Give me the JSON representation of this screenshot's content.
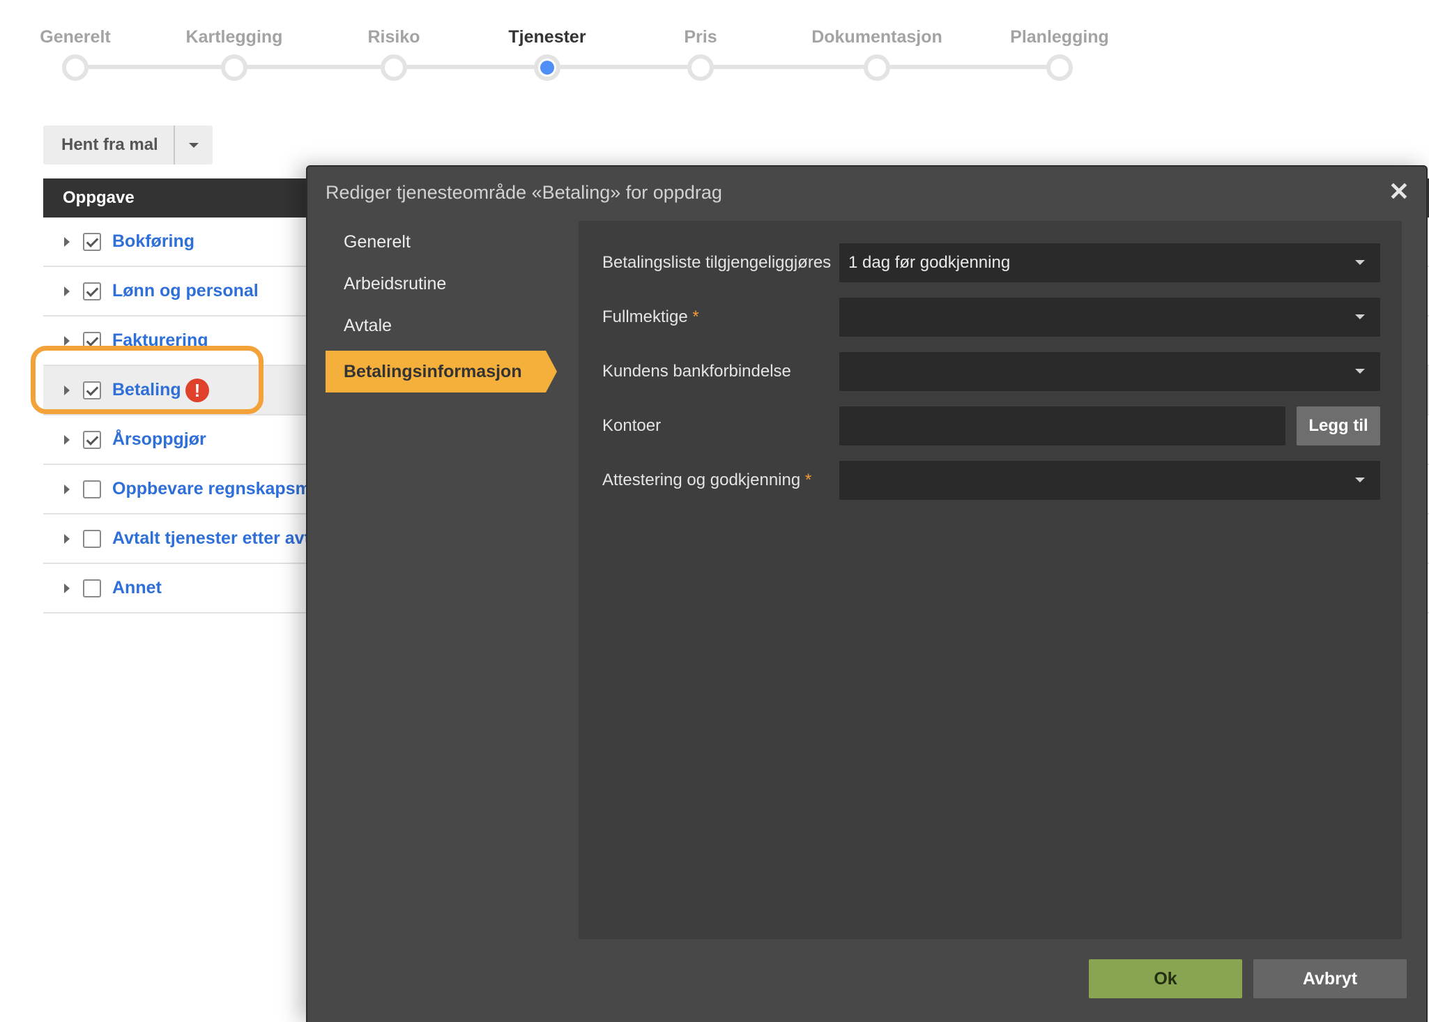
{
  "stepper": {
    "steps": [
      {
        "label": "Generelt",
        "state": "done"
      },
      {
        "label": "Kartlegging",
        "state": "done"
      },
      {
        "label": "Risiko",
        "state": "done"
      },
      {
        "label": "Tjenester",
        "state": "active"
      },
      {
        "label": "Pris",
        "state": "todo"
      },
      {
        "label": "Dokumentasjon",
        "state": "todo"
      },
      {
        "label": "Planlegging",
        "state": "todo"
      }
    ],
    "active_color": "#4f8ef7"
  },
  "template_button": {
    "label": "Hent fra mal",
    "dropdown_icon": "chevron-down-icon"
  },
  "task_table": {
    "header": "Oppgave",
    "rows": [
      {
        "label": "Bokføring",
        "checked": true
      },
      {
        "label": "Lønn og personal",
        "checked": true
      },
      {
        "label": "Fakturering",
        "checked": true
      },
      {
        "label": "Betaling",
        "checked": true,
        "warning": "!"
      },
      {
        "label": "Årsoppgjør",
        "checked": true
      },
      {
        "label": "Oppbevare regnskapsma",
        "checked": false
      },
      {
        "label": "Avtalt tjenester etter avt",
        "checked": false
      },
      {
        "label": "Annet",
        "checked": false
      }
    ],
    "link_color": "#2f6fd8",
    "warning_color": "#e0412a",
    "highlight_color": "#f3a23a"
  },
  "modal": {
    "title": "Rediger tjenesteområde «Betaling» for oppdrag",
    "close_icon": "close-icon",
    "nav": [
      {
        "label": "Generelt",
        "active": false
      },
      {
        "label": "Arbeidsrutine",
        "active": false
      },
      {
        "label": "Avtale",
        "active": false
      },
      {
        "label": "Betalingsinformasjon",
        "active": true
      }
    ],
    "accent_color": "#f5b03c",
    "form": {
      "payment_list": {
        "label": "Betalingsliste tilgjengeliggjøres",
        "value": "1 dag før godkjenning"
      },
      "proxies": {
        "label": "Fullmektige",
        "required": "*",
        "value": ""
      },
      "bank": {
        "label": "Kundens bankforbindelse",
        "value": ""
      },
      "accounts": {
        "label": "Kontoer",
        "value": "",
        "add_label": "Legg til"
      },
      "attestation": {
        "label": "Attestering og godkjenning",
        "required": "*",
        "value": ""
      }
    },
    "ok_label": "Ok",
    "cancel_label": "Avbryt"
  }
}
